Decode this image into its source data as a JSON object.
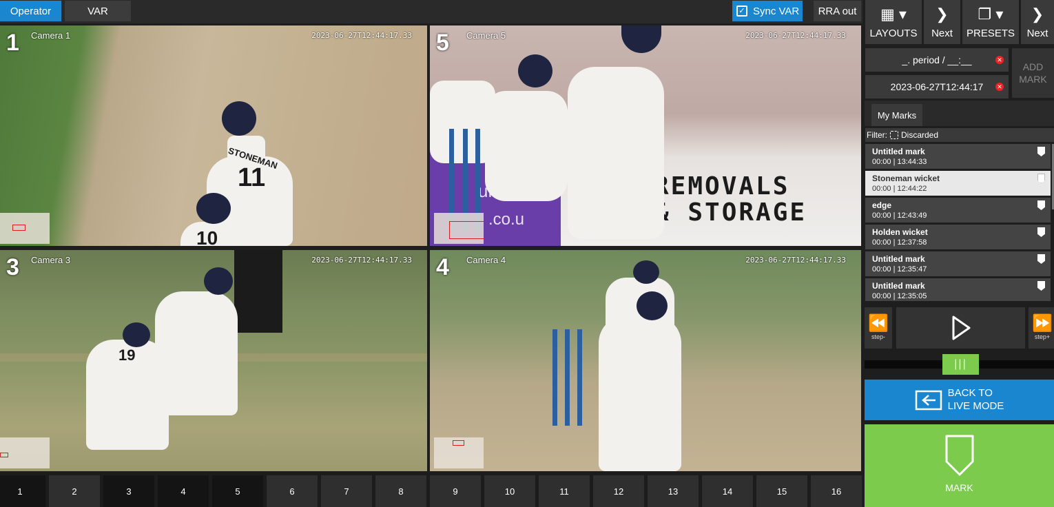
{
  "topbar": {
    "operator_label": "Operator",
    "var_label": "VAR",
    "sync_label": "Sync VAR",
    "rra_label": "RRA out"
  },
  "tiles": [
    {
      "num": "1",
      "name": "Camera 1",
      "ts": "2023-06-27T12:44:17.33"
    },
    {
      "num": "5",
      "name": "Camera 5",
      "ts": "2023-06-27T12:44:17.33"
    },
    {
      "num": "3",
      "name": "Camera 3",
      "ts": "2023-06-27T12:44:17.33"
    },
    {
      "num": "4",
      "name": "Camera 4",
      "ts": "2023-06-27T12:44:17.33"
    }
  ],
  "scene": {
    "shirt_name": "STONEMAN",
    "shirt_11": "11",
    "shirt_10": "10",
    "shirt_19": "19",
    "banner_line1": "REMOVALS",
    "banner_line2": "& STORAGE",
    "sponsor_text": "urance",
    "sponsor_url": ".co.u"
  },
  "presets": [
    "1",
    "2",
    "3",
    "4",
    "5",
    "6",
    "7",
    "8",
    "9",
    "10",
    "11",
    "12",
    "13",
    "14",
    "15",
    "16"
  ],
  "right_panel": {
    "layouts_label": "LAYOUTS",
    "next_label_1": "Next",
    "presets_label": "PRESETS",
    "next_label_2": "Next",
    "period_field": "_. period / __:__",
    "time_field": "2023-06-27T12:44:17",
    "add_mark_label": "ADD MARK",
    "tab_label": "My Marks",
    "filter_label": "Filter:",
    "discarded_label": "Discarded",
    "marks": [
      {
        "name": "Untitled mark",
        "time": "00:00 | 13:44:33"
      },
      {
        "name": "Stoneman wicket",
        "time": "00:00 | 12:44:22"
      },
      {
        "name": "edge",
        "time": "00:00 | 12:43:49"
      },
      {
        "name": "Holden wicket",
        "time": "00:00 | 12:37:58"
      },
      {
        "name": "Untitled mark",
        "time": "00:00 | 12:35:47"
      },
      {
        "name": "Untitled mark",
        "time": "00:00 | 12:35:05"
      }
    ],
    "step_back_label": "step-",
    "step_fwd_label": "step+",
    "scrub_grip": "|||",
    "live_label_1": "BACK TO",
    "live_label_2": "LIVE MODE",
    "mark_label": "MARK"
  },
  "colors": {
    "accent_blue": "#1a86cf",
    "accent_green": "#7dcb4c",
    "panel_dark": "#1e1e1e",
    "roi_red": "#d52020"
  }
}
